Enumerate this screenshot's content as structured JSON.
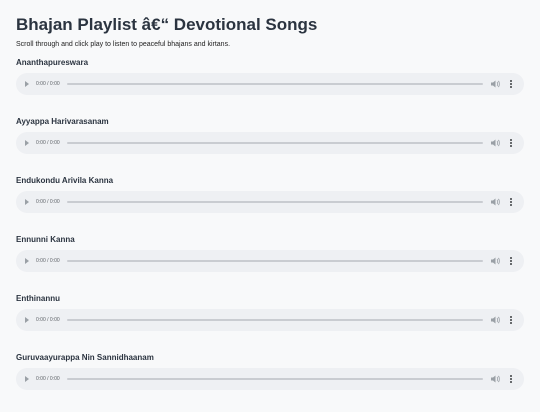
{
  "header": {
    "title": "Bhajan Playlist â€“ Devotional Songs",
    "subtitle": "Scroll through and click play to listen to peaceful bhajans and kirtans."
  },
  "songs": [
    {
      "title": "Ananthapureswara",
      "time": "0:00 / 0:00"
    },
    {
      "title": "Ayyappa Harivarasanam",
      "time": "0:00 / 0:00"
    },
    {
      "title": "Endukondu Arivila Kanna",
      "time": "0:00 / 0:00"
    },
    {
      "title": "Ennunni Kanna",
      "time": "0:00 / 0:00"
    },
    {
      "title": "Enthinannu",
      "time": "0:00 / 0:00"
    },
    {
      "title": "Guruvaayurappa Nin Sannidhaanam",
      "time": "0:00 / 0:00"
    }
  ],
  "player_icons": {
    "play": "play-icon",
    "volume": "volume-icon",
    "more": "more-options-icon"
  },
  "colors": {
    "background": "#f8f9fa",
    "player": "#eef0f3",
    "heading": "#2b3440"
  }
}
